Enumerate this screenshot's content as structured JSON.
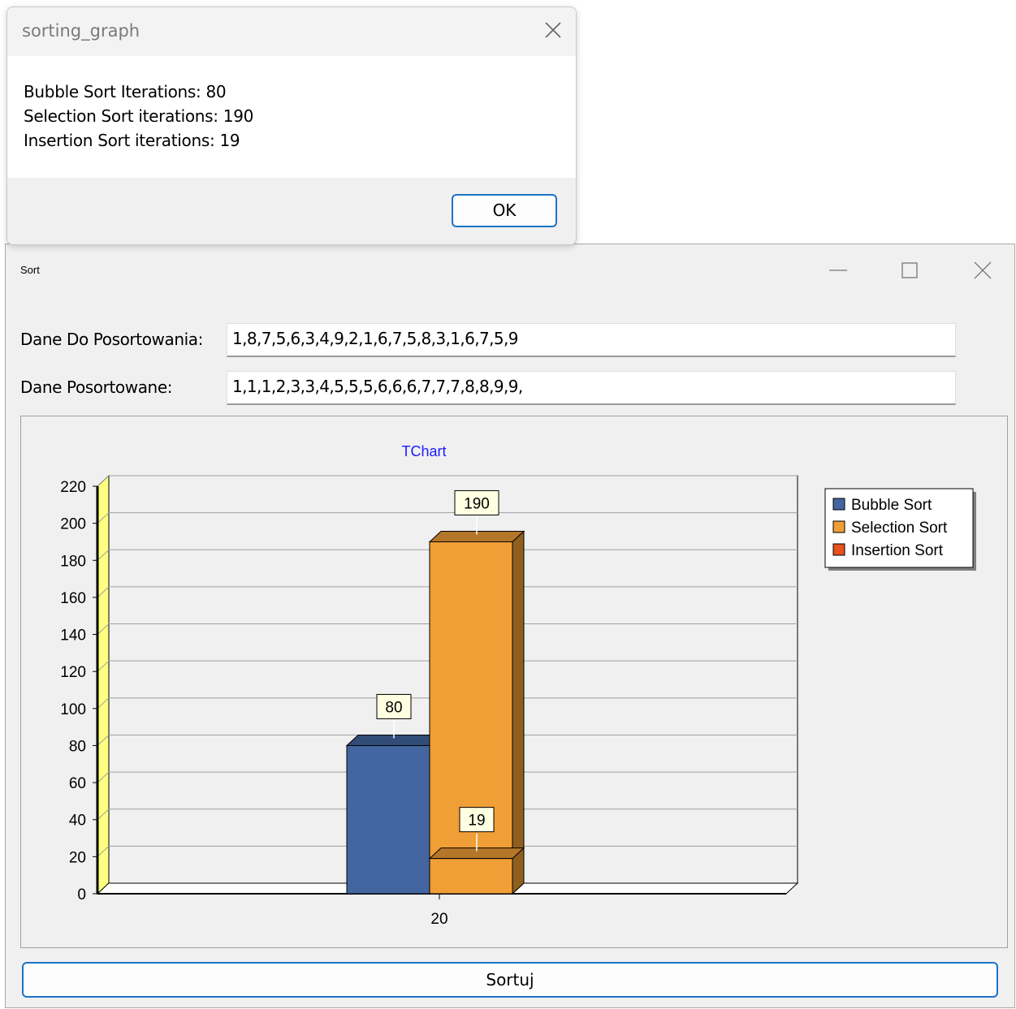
{
  "dialog": {
    "title": "sorting_graph",
    "lines": [
      "Bubble Sort Iterations: 80",
      "Selection Sort iterations: 190",
      "Insertion Sort iterations: 19"
    ],
    "ok_label": "OK",
    "close_icon": "close-icon"
  },
  "form": {
    "title": "Sort",
    "icons": [
      "minimize-icon",
      "maximize-icon",
      "close-icon"
    ],
    "input_label": "Dane Do Posortowania:",
    "input_value": "1,8,7,5,6,3,4,9,2,1,6,7,5,8,3,1,6,7,5,9",
    "output_label": "Dane Posortowane:",
    "output_value": "1,1,1,2,3,3,4,5,5,5,6,6,6,7,7,7,8,8,9,9,",
    "sort_button": "Sortuj"
  },
  "chart_data": {
    "type": "bar",
    "title": "TChart",
    "categories": [
      "20"
    ],
    "series": [
      {
        "name": "Bubble Sort",
        "values": [
          80
        ],
        "color": "#4366a0",
        "label": "80"
      },
      {
        "name": "Selection Sort",
        "values": [
          190
        ],
        "color": "#f09e36",
        "label": "190"
      },
      {
        "name": "Insertion Sort",
        "values": [
          19
        ],
        "color": "#f09e36",
        "label": "19",
        "legend_color": "#e8501c"
      }
    ],
    "ylim": [
      0,
      220
    ],
    "yticks": [
      "0",
      "20",
      "40",
      "60",
      "80",
      "100",
      "120",
      "140",
      "160",
      "180",
      "200",
      "220"
    ],
    "grid": true,
    "legend": "right",
    "view3d": true,
    "title_color": "#1a1aff"
  }
}
